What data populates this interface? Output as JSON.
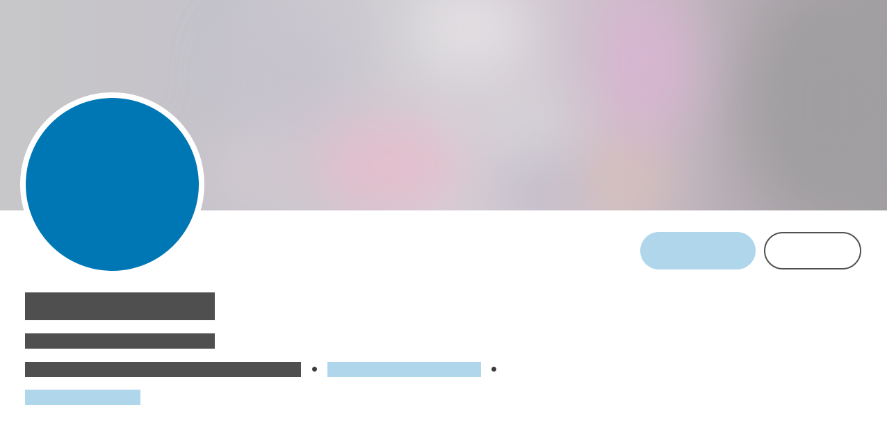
{
  "profile_card": {
    "colors": {
      "avatar_fill": "#0077b5",
      "primary_button": "#b0d6eb",
      "link_placeholder": "#b0d6eb",
      "text_placeholder": "#4f4f4f",
      "secondary_button_border": "#505050",
      "background": "#ffffff"
    },
    "cover": {
      "style": "blurred-gradient"
    },
    "actions": {
      "primary_label": "",
      "secondary_label": ""
    }
  }
}
